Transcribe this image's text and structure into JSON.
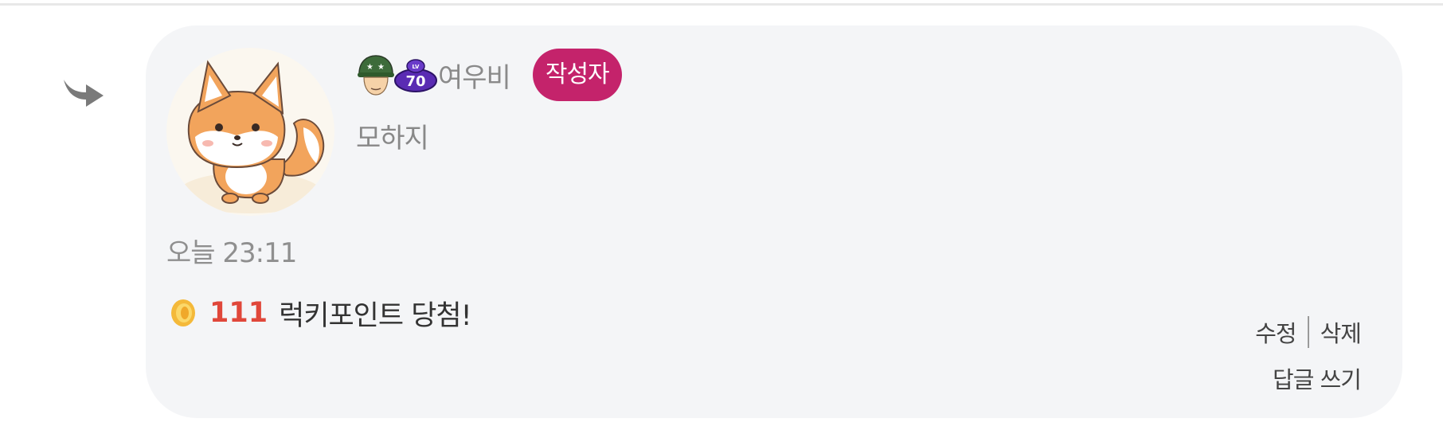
{
  "author": {
    "rank_icon": "soldier-helmet-icon",
    "level_icon": "level-70-badge-icon",
    "level_text": "70",
    "level_prefix": "LV",
    "nickname": "여우비",
    "badge": "작성자"
  },
  "status_message": "모하지",
  "timestamp": "오늘 23:11",
  "lucky": {
    "coin_icon": "coin-icon",
    "points": "111",
    "text": "럭키포인트 당첨!"
  },
  "actions": {
    "edit": "수정",
    "delete": "삭제",
    "reply": "답글 쓰기"
  },
  "colors": {
    "badge_bg": "#c4236b",
    "points": "#e0473a",
    "card_bg": "#f4f5f7"
  }
}
